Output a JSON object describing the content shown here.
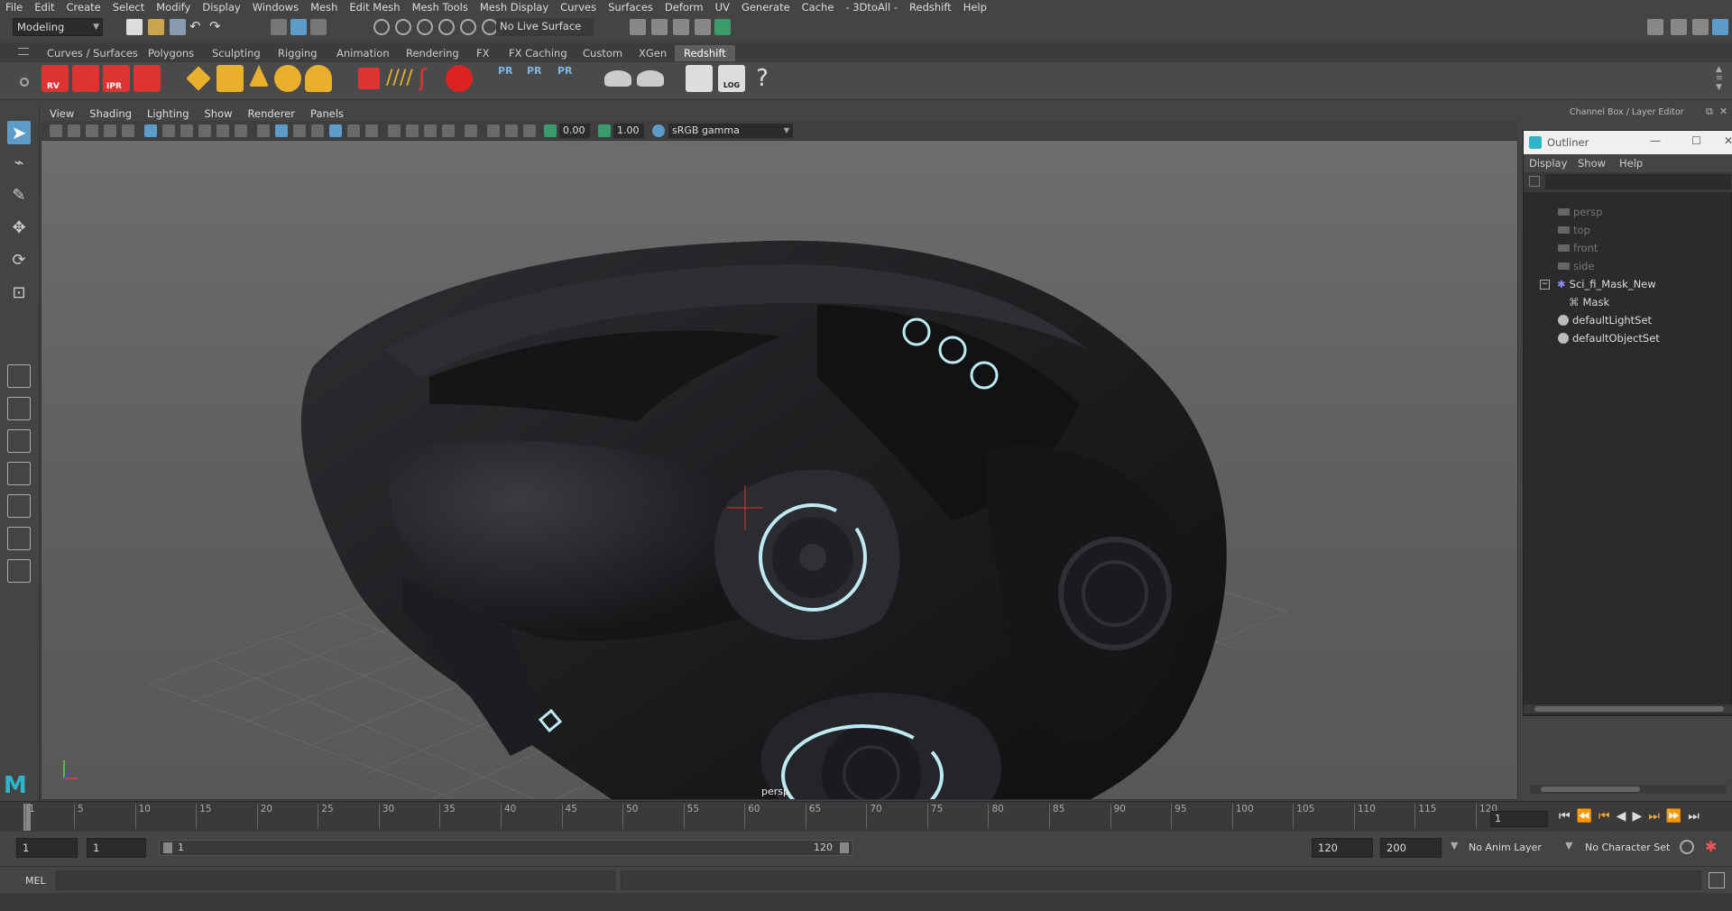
{
  "menubar": {
    "items": [
      "File",
      "Edit",
      "Create",
      "Select",
      "Modify",
      "Display",
      "Windows",
      "Mesh",
      "Edit Mesh",
      "Mesh Tools",
      "Mesh Display",
      "Curves",
      "Surfaces",
      "Deform",
      "UV",
      "Generate",
      "Cache",
      "- 3DtoAll -",
      "Redshift",
      "Help"
    ]
  },
  "status": {
    "mode": "Modeling",
    "live_surface": "No Live Surface"
  },
  "shelf": {
    "tabs": [
      "Curves / Surfaces",
      "Polygons",
      "Sculpting",
      "Rigging",
      "Animation",
      "Rendering",
      "FX",
      "FX Caching",
      "Custom",
      "XGen",
      "Redshift"
    ],
    "active": "Redshift",
    "icon_labels": [
      "RV",
      "IPR",
      "PR",
      "PR",
      "PR",
      "LOG",
      "?"
    ]
  },
  "viewport": {
    "menu": [
      "View",
      "Shading",
      "Lighting",
      "Show",
      "Renderer",
      "Panels"
    ],
    "exposure": "0.00",
    "gamma": "1.00",
    "colorspace": "sRGB gamma",
    "camera_label": "persp"
  },
  "rightpanel": {
    "header": "Channel Box / Layer Editor",
    "outliner_title": "Outliner",
    "menu": [
      "Display",
      "Show",
      "Help"
    ],
    "items": [
      {
        "label": "persp",
        "type": "camera"
      },
      {
        "label": "top",
        "type": "camera"
      },
      {
        "label": "front",
        "type": "camera"
      },
      {
        "label": "side",
        "type": "camera"
      },
      {
        "label": "Sci_fi_Mask_New",
        "type": "group"
      },
      {
        "label": "Mask",
        "type": "mesh"
      },
      {
        "label": "defaultLightSet",
        "type": "set"
      },
      {
        "label": "defaultObjectSet",
        "type": "set"
      }
    ]
  },
  "timeline": {
    "ticks": [
      "1",
      "5",
      "10",
      "15",
      "20",
      "25",
      "30",
      "35",
      "40",
      "45",
      "50",
      "55",
      "60",
      "65",
      "70",
      "75",
      "80",
      "85",
      "90",
      "95",
      "100",
      "105",
      "110",
      "115",
      "120"
    ],
    "current_frame": "1"
  },
  "range": {
    "start": "1",
    "anim_start": "1",
    "range_start": "1",
    "range_end": "120",
    "anim_end": "120",
    "end": "200",
    "anim_layer": "No Anim Layer",
    "char_set": "No Character Set"
  },
  "cmd": {
    "lang": "MEL"
  },
  "colors": {
    "accent": "#5d9cc8",
    "glow": "#bfe9f3",
    "active_tab": "#5d5d5d"
  }
}
